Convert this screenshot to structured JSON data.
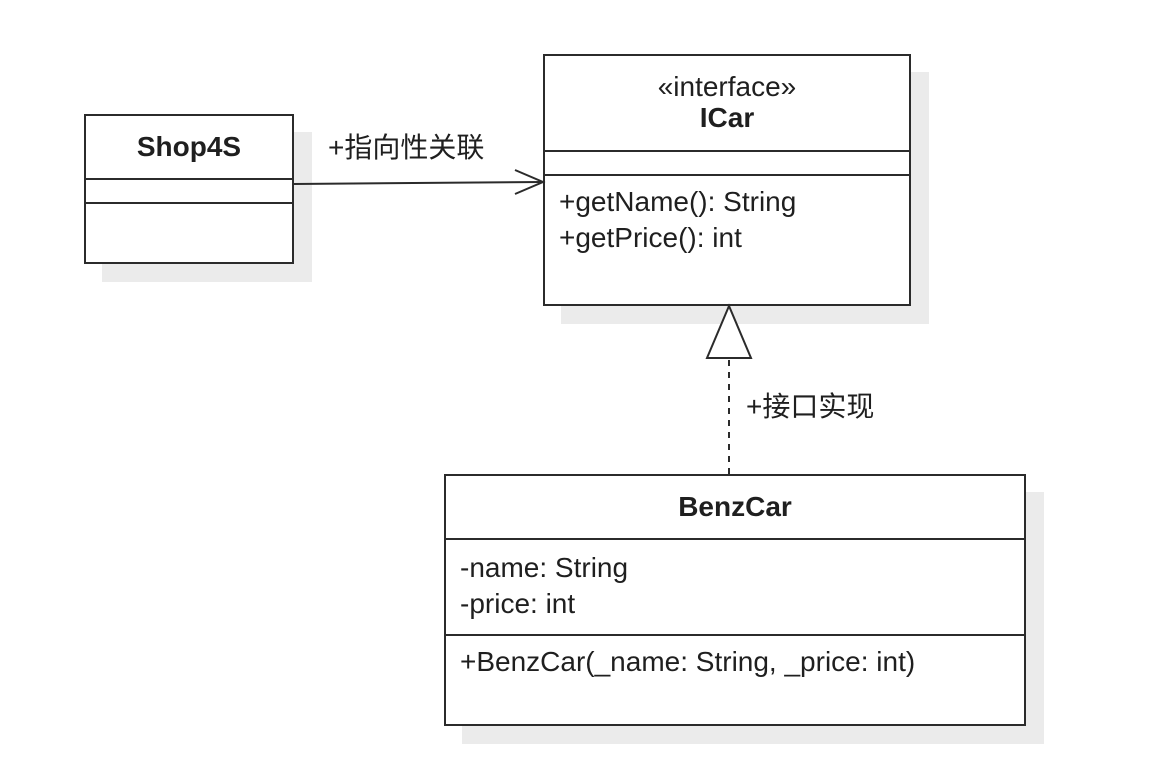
{
  "classes": {
    "shop4s": {
      "name": "Shop4S",
      "attributes": [],
      "operations": []
    },
    "icar": {
      "stereotype": "«interface»",
      "name": "ICar",
      "attributes": [],
      "operations": [
        "+getName(): String",
        "+getPrice(): int"
      ]
    },
    "benzcar": {
      "name": "BenzCar",
      "attributes": [
        "-name: String",
        "-price: int"
      ],
      "operations": [
        "+BenzCar(_name: String, _price: int)"
      ]
    }
  },
  "relations": [
    {
      "type": "directed-association",
      "from": "Shop4S",
      "to": "ICar",
      "label": "+指向性关联",
      "line_style": "solid",
      "arrowhead": "open"
    },
    {
      "type": "realization",
      "from": "BenzCar",
      "to": "ICar",
      "label": "+接口实现",
      "line_style": "dashed",
      "arrowhead": "hollow-triangle"
    }
  ],
  "colors": {
    "stroke": "#2b2b2b",
    "text": "#1f1f1f",
    "background": "#ffffff",
    "shadow": "rgba(0,0,0,0.08)"
  }
}
